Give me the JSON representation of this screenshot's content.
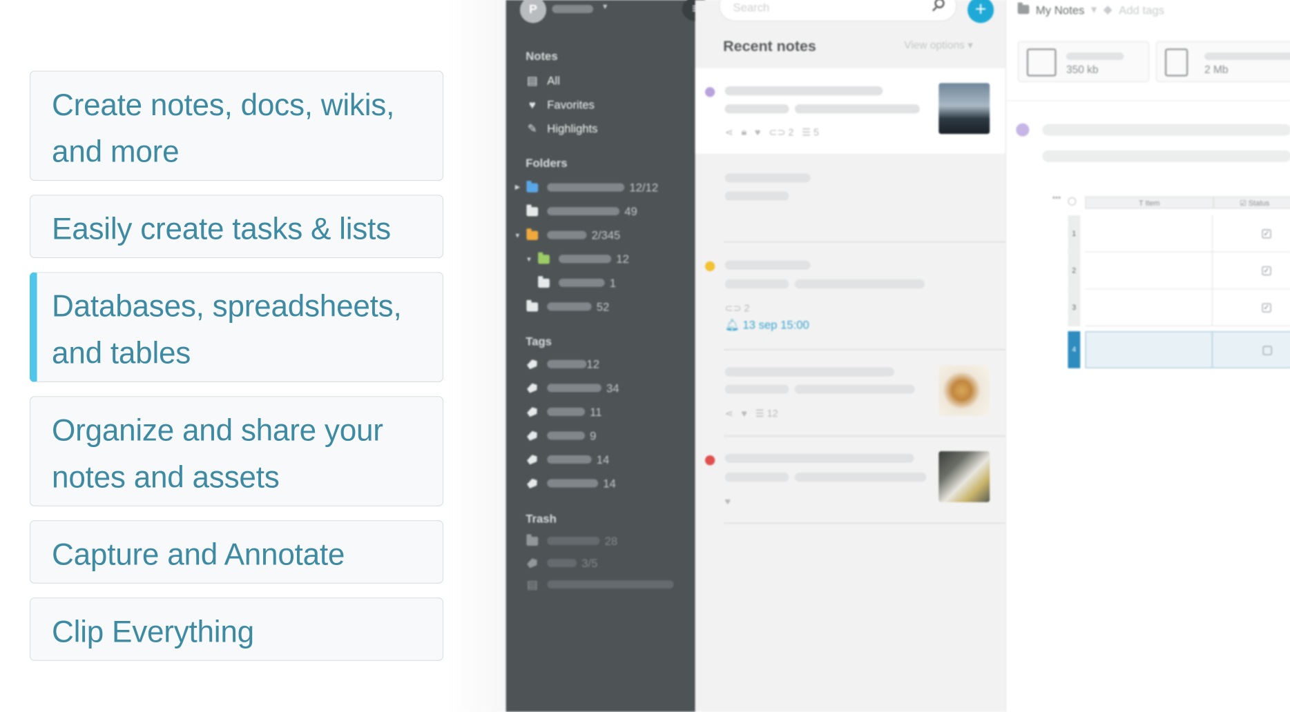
{
  "features": [
    {
      "label": "Create notes, docs, wikis, and more",
      "active": false
    },
    {
      "label": "Easily create tasks & lists",
      "active": false
    },
    {
      "label": "Databases, spreadsheets, and tables",
      "active": true
    },
    {
      "label": "Organize and share your notes and assets",
      "active": false
    },
    {
      "label": "Capture and Annotate",
      "active": false
    },
    {
      "label": "Clip Everything",
      "active": false
    }
  ],
  "sidebar": {
    "avatar_letter": "P",
    "notes_heading": "Notes",
    "notes_items": [
      {
        "label": "All",
        "icon": "note-icon"
      },
      {
        "label": "Favorites",
        "icon": "heart-icon"
      },
      {
        "label": "Highlights",
        "icon": "highlighter-icon"
      }
    ],
    "folders_heading": "Folders",
    "folders": [
      {
        "count": "12/12",
        "color": "#5aa7e8"
      },
      {
        "count": "49",
        "color": "#e6e9ea"
      },
      {
        "count": "2/345",
        "color": "#f0a93b"
      },
      {
        "count": "12",
        "color": "#9ccc65"
      },
      {
        "count": "1",
        "color": "#e6e9ea"
      },
      {
        "count": "52",
        "color": "#e6e9ea"
      }
    ],
    "tags_heading": "Tags",
    "tags": [
      "12",
      "34",
      "11",
      "9",
      "14",
      "14"
    ],
    "trash_heading": "Trash",
    "trash_items": [
      "28",
      "3/5",
      ""
    ]
  },
  "notes_list": {
    "search_placeholder": "Search",
    "title": "Recent notes",
    "view_options": "View options",
    "note1_meta": {
      "links": "2",
      "list": "5"
    },
    "note3_meta": {
      "links": "2"
    },
    "reminder": "13 sep 15:00",
    "note4_meta": {
      "list": "12"
    },
    "colors": {
      "purple": "#b9a3dd",
      "yellow": "#f2c232",
      "red": "#e04e4e"
    }
  },
  "detail": {
    "breadcrumb_folder": "My Notes",
    "add_tags": "Add tags",
    "attachments": [
      {
        "size": "350 kb",
        "icon": "video-icon"
      },
      {
        "size": "2 Mb",
        "icon": "zip-icon"
      }
    ],
    "table": {
      "col_item": "Item",
      "col_status": "Status",
      "rows": [
        {
          "num": "1",
          "checked": true
        },
        {
          "num": "2",
          "checked": true
        },
        {
          "num": "3",
          "checked": true
        },
        {
          "num": "4",
          "checked": false
        }
      ]
    }
  }
}
